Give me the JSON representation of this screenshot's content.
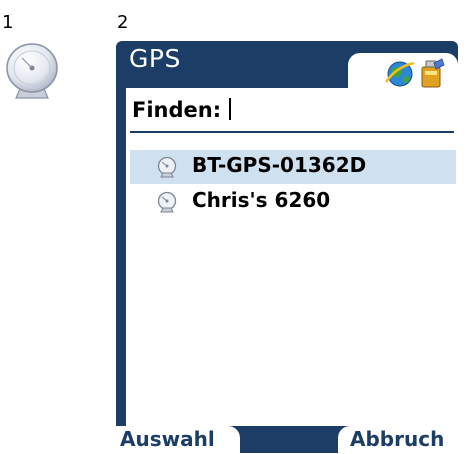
{
  "steps": {
    "first": "1",
    "second": "2"
  },
  "icons": {
    "large_device": "gps-dish-icon",
    "status_globe": "globe-icon",
    "status_battery": "battery-icon",
    "list_device": "gps-device-icon"
  },
  "window": {
    "title": "GPS"
  },
  "search": {
    "label": "Finden:",
    "value": ""
  },
  "devices": {
    "items": [
      {
        "label": "BT-GPS-01362D",
        "selected": true
      },
      {
        "label": "Chris's 6260",
        "selected": false
      }
    ]
  },
  "softkeys": {
    "left_label": "Auswahl",
    "right_label": "Abbruch"
  },
  "colors": {
    "frame": "#1c3d66",
    "selection": "#cfe0ef",
    "background": "#ffffff"
  }
}
